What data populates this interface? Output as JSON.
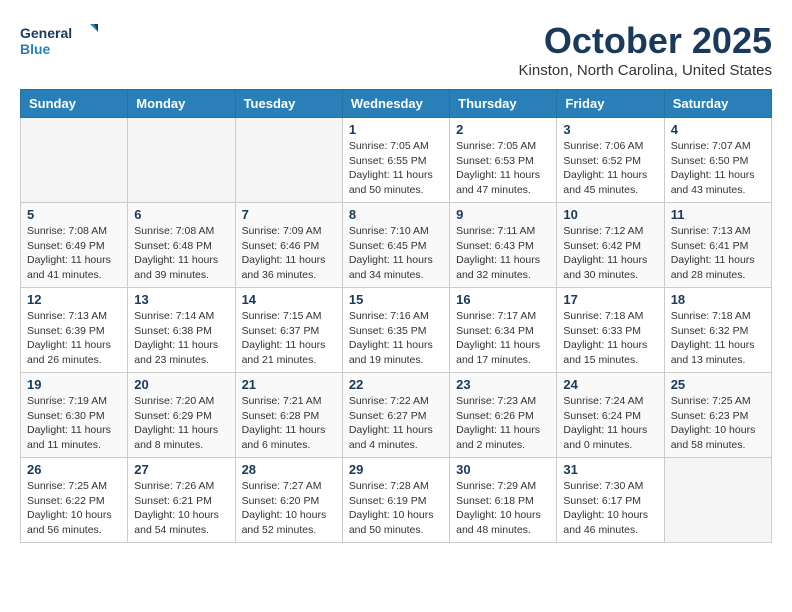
{
  "header": {
    "logo_line1": "General",
    "logo_line2": "Blue",
    "month": "October 2025",
    "location": "Kinston, North Carolina, United States"
  },
  "days_of_week": [
    "Sunday",
    "Monday",
    "Tuesday",
    "Wednesday",
    "Thursday",
    "Friday",
    "Saturday"
  ],
  "weeks": [
    [
      {
        "day": "",
        "info": ""
      },
      {
        "day": "",
        "info": ""
      },
      {
        "day": "",
        "info": ""
      },
      {
        "day": "1",
        "info": "Sunrise: 7:05 AM\nSunset: 6:55 PM\nDaylight: 11 hours\nand 50 minutes."
      },
      {
        "day": "2",
        "info": "Sunrise: 7:05 AM\nSunset: 6:53 PM\nDaylight: 11 hours\nand 47 minutes."
      },
      {
        "day": "3",
        "info": "Sunrise: 7:06 AM\nSunset: 6:52 PM\nDaylight: 11 hours\nand 45 minutes."
      },
      {
        "day": "4",
        "info": "Sunrise: 7:07 AM\nSunset: 6:50 PM\nDaylight: 11 hours\nand 43 minutes."
      }
    ],
    [
      {
        "day": "5",
        "info": "Sunrise: 7:08 AM\nSunset: 6:49 PM\nDaylight: 11 hours\nand 41 minutes."
      },
      {
        "day": "6",
        "info": "Sunrise: 7:08 AM\nSunset: 6:48 PM\nDaylight: 11 hours\nand 39 minutes."
      },
      {
        "day": "7",
        "info": "Sunrise: 7:09 AM\nSunset: 6:46 PM\nDaylight: 11 hours\nand 36 minutes."
      },
      {
        "day": "8",
        "info": "Sunrise: 7:10 AM\nSunset: 6:45 PM\nDaylight: 11 hours\nand 34 minutes."
      },
      {
        "day": "9",
        "info": "Sunrise: 7:11 AM\nSunset: 6:43 PM\nDaylight: 11 hours\nand 32 minutes."
      },
      {
        "day": "10",
        "info": "Sunrise: 7:12 AM\nSunset: 6:42 PM\nDaylight: 11 hours\nand 30 minutes."
      },
      {
        "day": "11",
        "info": "Sunrise: 7:13 AM\nSunset: 6:41 PM\nDaylight: 11 hours\nand 28 minutes."
      }
    ],
    [
      {
        "day": "12",
        "info": "Sunrise: 7:13 AM\nSunset: 6:39 PM\nDaylight: 11 hours\nand 26 minutes."
      },
      {
        "day": "13",
        "info": "Sunrise: 7:14 AM\nSunset: 6:38 PM\nDaylight: 11 hours\nand 23 minutes."
      },
      {
        "day": "14",
        "info": "Sunrise: 7:15 AM\nSunset: 6:37 PM\nDaylight: 11 hours\nand 21 minutes."
      },
      {
        "day": "15",
        "info": "Sunrise: 7:16 AM\nSunset: 6:35 PM\nDaylight: 11 hours\nand 19 minutes."
      },
      {
        "day": "16",
        "info": "Sunrise: 7:17 AM\nSunset: 6:34 PM\nDaylight: 11 hours\nand 17 minutes."
      },
      {
        "day": "17",
        "info": "Sunrise: 7:18 AM\nSunset: 6:33 PM\nDaylight: 11 hours\nand 15 minutes."
      },
      {
        "day": "18",
        "info": "Sunrise: 7:18 AM\nSunset: 6:32 PM\nDaylight: 11 hours\nand 13 minutes."
      }
    ],
    [
      {
        "day": "19",
        "info": "Sunrise: 7:19 AM\nSunset: 6:30 PM\nDaylight: 11 hours\nand 11 minutes."
      },
      {
        "day": "20",
        "info": "Sunrise: 7:20 AM\nSunset: 6:29 PM\nDaylight: 11 hours\nand 8 minutes."
      },
      {
        "day": "21",
        "info": "Sunrise: 7:21 AM\nSunset: 6:28 PM\nDaylight: 11 hours\nand 6 minutes."
      },
      {
        "day": "22",
        "info": "Sunrise: 7:22 AM\nSunset: 6:27 PM\nDaylight: 11 hours\nand 4 minutes."
      },
      {
        "day": "23",
        "info": "Sunrise: 7:23 AM\nSunset: 6:26 PM\nDaylight: 11 hours\nand 2 minutes."
      },
      {
        "day": "24",
        "info": "Sunrise: 7:24 AM\nSunset: 6:24 PM\nDaylight: 11 hours\nand 0 minutes."
      },
      {
        "day": "25",
        "info": "Sunrise: 7:25 AM\nSunset: 6:23 PM\nDaylight: 10 hours\nand 58 minutes."
      }
    ],
    [
      {
        "day": "26",
        "info": "Sunrise: 7:25 AM\nSunset: 6:22 PM\nDaylight: 10 hours\nand 56 minutes."
      },
      {
        "day": "27",
        "info": "Sunrise: 7:26 AM\nSunset: 6:21 PM\nDaylight: 10 hours\nand 54 minutes."
      },
      {
        "day": "28",
        "info": "Sunrise: 7:27 AM\nSunset: 6:20 PM\nDaylight: 10 hours\nand 52 minutes."
      },
      {
        "day": "29",
        "info": "Sunrise: 7:28 AM\nSunset: 6:19 PM\nDaylight: 10 hours\nand 50 minutes."
      },
      {
        "day": "30",
        "info": "Sunrise: 7:29 AM\nSunset: 6:18 PM\nDaylight: 10 hours\nand 48 minutes."
      },
      {
        "day": "31",
        "info": "Sunrise: 7:30 AM\nSunset: 6:17 PM\nDaylight: 10 hours\nand 46 minutes."
      },
      {
        "day": "",
        "info": ""
      }
    ]
  ]
}
